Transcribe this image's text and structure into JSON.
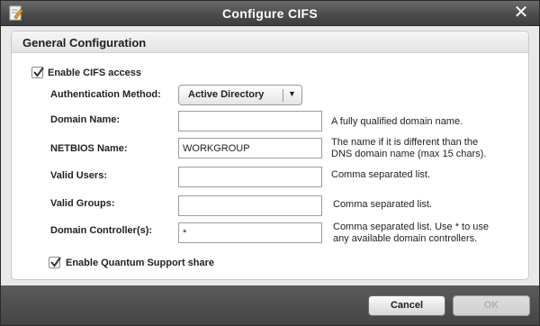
{
  "window": {
    "title": "Configure CIFS",
    "icon": "document-edit-icon"
  },
  "panel": {
    "title": "General Configuration"
  },
  "enable_cifs": {
    "label": "Enable CIFS access",
    "checked": true
  },
  "auth": {
    "label": "Authentication Method:",
    "selected": "Active Directory"
  },
  "domain_name": {
    "label": "Domain Name:",
    "value": "",
    "hint": "A fully qualified domain name."
  },
  "netbios": {
    "label": "NETBIOS Name:",
    "value": "WORKGROUP",
    "hint_line1": "The name if it is different than the",
    "hint_line2": "DNS domain name (max 15 chars)."
  },
  "valid_users": {
    "label": "Valid Users:",
    "value": "",
    "hint": "Comma separated list."
  },
  "valid_groups": {
    "label": "Valid Groups:",
    "value": "",
    "hint": "Comma separated list."
  },
  "domain_controllers": {
    "label": "Domain Controller(s):",
    "value": "*",
    "hint_line1": "Comma separated list. Use * to use",
    "hint_line2": "any available domain controllers."
  },
  "quantum_support": {
    "label": "Enable Quantum Support share",
    "checked": true
  },
  "buttons": {
    "cancel": "Cancel",
    "ok": "OK"
  },
  "colors": {
    "titlebar": "#4c4c4c",
    "panel_bg": "#ffffff",
    "body_bg": "#e9e9e9"
  }
}
